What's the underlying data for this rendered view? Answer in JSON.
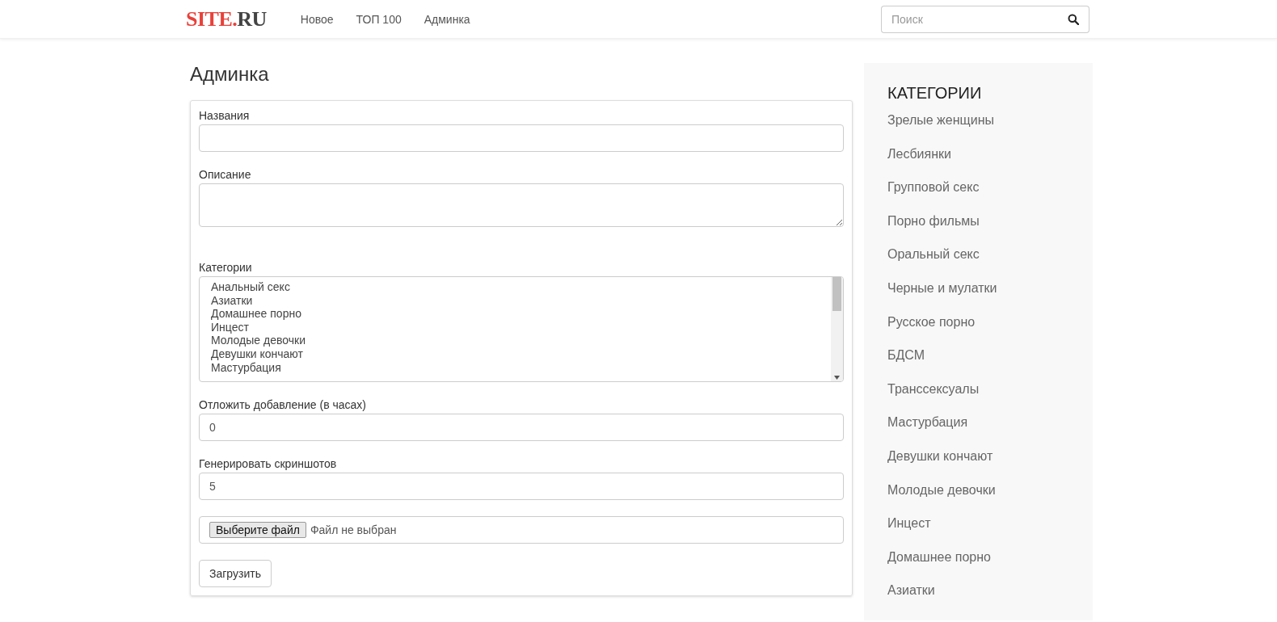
{
  "navbar": {
    "logo": {
      "accent": "SITE.",
      "rest": "RU"
    },
    "links": [
      {
        "label": "Новое",
        "selected": false
      },
      {
        "label": "ТОП 100",
        "selected": false
      },
      {
        "label": "Админка",
        "selected": false
      }
    ],
    "search": {
      "placeholder": "Поиск"
    }
  },
  "main": {
    "title": "Админка",
    "form": {
      "fields": [
        {
          "kind": "input",
          "label": "Названия"
        },
        {
          "kind": "textarea",
          "label": "Описание"
        },
        {
          "kind": "multiselect",
          "label": "Категории",
          "options": [
            "Анальный секс",
            "Азиатки",
            "Домашнее порно",
            "Инцест",
            "Молодые девочки",
            "Девушки кончают",
            "Мастурбация"
          ]
        },
        {
          "kind": "input",
          "label": "Отложить добавление (в часах)",
          "value": "0"
        },
        {
          "kind": "input",
          "label": "Генерировать скриншотов",
          "value": "5"
        },
        {
          "kind": "file",
          "button": "Выберите файл",
          "status": "Файл не выбран"
        }
      ],
      "submit": "Загрузить"
    }
  },
  "sidebar": {
    "title": "КАТЕГОРИИ",
    "items": [
      "Зрелые женщины",
      "Лесбиянки",
      "Групповой секс",
      "Порно фильмы",
      "Оральный секс",
      "Черные и мулатки",
      "Русское порно",
      "БДСМ",
      "Транссексуалы",
      "Мастурбация",
      "Девушки кончают",
      "Молодые девочки",
      "Инцест",
      "Домашнее порно",
      "Азиатки"
    ]
  }
}
